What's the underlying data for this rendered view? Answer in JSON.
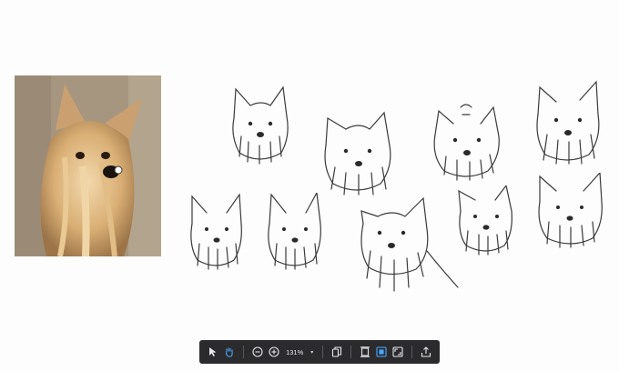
{
  "toolbar": {
    "zoom_label": "131%",
    "zoom_caret": "▾",
    "buttons": [
      {
        "name": "select-tool"
      },
      {
        "name": "hand-tool",
        "active": true
      },
      {
        "name": "zoom-out"
      },
      {
        "name": "zoom-in"
      },
      {
        "name": "copy"
      },
      {
        "name": "fit-height"
      },
      {
        "name": "fit-width",
        "active": true
      },
      {
        "name": "fullscreen"
      },
      {
        "name": "share"
      }
    ]
  },
  "colors": {
    "toolbar_bg": "#2b2b2d",
    "active_icon": "#4aa8ff",
    "sketch_stroke": "#3a3a3a"
  }
}
